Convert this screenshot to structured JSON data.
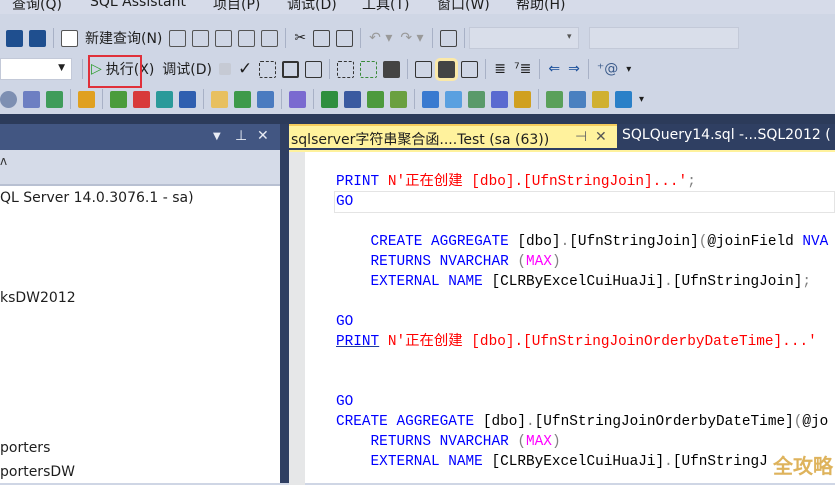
{
  "menu": [
    "查询(Q)",
    "SQL Assistant",
    "项目(P)",
    "调试(D)",
    "工具(T)",
    "窗口(W)",
    "帮助(H)"
  ],
  "toolbar1": {
    "new_query": "新建查询(N)",
    "icons": [
      "save-icon",
      "save-all-icon",
      "new-query-icon",
      "mdx-query-icon",
      "dmx-query-icon",
      "xmla-query-icon",
      "dax-query-icon",
      "cut-icon",
      "copy-icon",
      "paste-icon",
      "undo-icon",
      "redo-icon",
      "activity-monitor-icon"
    ]
  },
  "toolbar2": {
    "execute": "执行(X)",
    "debug": "调试(D)",
    "icons": [
      "execute-play-icon",
      "stop-icon",
      "parse-check-icon",
      "display-plan-icon",
      "query-options-icon",
      "intellisense-icon",
      "results-to-text-icon",
      "results-to-grid-icon",
      "results-to-file-icon",
      "comment-icon",
      "uncomment-icon",
      "decrease-indent-icon",
      "increase-indent-icon",
      "specify-values-icon"
    ]
  },
  "colors": {
    "accent_tab": "#fff29d",
    "title_bar": "#425682",
    "keyword": "#0000ff",
    "string": "#ff0000",
    "function": "#ff00ff",
    "highlight_box": "#e0303a"
  },
  "object_explorer": {
    "header": "ʌ",
    "items": [
      "QL Server 14.0.3076.1 - sa)",
      "ksDW2012",
      "porters",
      "portersDW"
    ]
  },
  "tabs": [
    {
      "label": "sqlserver字符串聚合函....Test (sa (63))",
      "active": true
    },
    {
      "label": "SQLQuery14.sql -...SQL2012 (",
      "active": false
    }
  ],
  "code": [
    [
      [
        "k",
        "PRINT"
      ],
      [
        "n",
        " "
      ],
      [
        "s",
        "N'正在创建 [dbo].[UfnStringJoin]...'"
      ],
      [
        "p",
        ";"
      ]
    ],
    [
      [
        "k",
        "GO"
      ]
    ],
    [],
    [
      [
        "n",
        "    "
      ],
      [
        "k",
        "CREATE AGGREGATE"
      ],
      [
        "n",
        " [dbo]"
      ],
      [
        "p",
        "."
      ],
      [
        "n",
        "[UfnStringJoin]"
      ],
      [
        "p",
        "("
      ],
      [
        "n",
        "@joinField "
      ],
      [
        "k",
        "NVA"
      ]
    ],
    [
      [
        "n",
        "    "
      ],
      [
        "k",
        "RETURNS NVARCHAR"
      ],
      [
        "n",
        " "
      ],
      [
        "p",
        "("
      ],
      [
        "m",
        "MAX"
      ],
      [
        "p",
        ")"
      ]
    ],
    [
      [
        "n",
        "    "
      ],
      [
        "k",
        "EXTERNAL NAME"
      ],
      [
        "n",
        " [CLRByExcelCuiHuaJi]"
      ],
      [
        "p",
        "."
      ],
      [
        "n",
        "[UfnStringJoin]"
      ],
      [
        "p",
        ";"
      ]
    ],
    [],
    [
      [
        "k",
        "GO"
      ]
    ],
    [
      [
        "k ul",
        "PRINT"
      ],
      [
        "n",
        " "
      ],
      [
        "s",
        "N'正在创建 [dbo].[UfnStringJoinOrderbyDateTime]...'"
      ]
    ],
    [],
    [],
    [
      [
        "k",
        "GO"
      ]
    ],
    [
      [
        "k",
        "CREATE AGGREGATE"
      ],
      [
        "n",
        " [dbo]"
      ],
      [
        "p",
        "."
      ],
      [
        "n",
        "[UfnStringJoinOrderbyDateTime]"
      ],
      [
        "p",
        "("
      ],
      [
        "n",
        "@jo"
      ]
    ],
    [
      [
        "n",
        "    "
      ],
      [
        "k",
        "RETURNS NVARCHAR"
      ],
      [
        "n",
        " "
      ],
      [
        "p",
        "("
      ],
      [
        "m",
        "MAX"
      ],
      [
        "p",
        ")"
      ]
    ],
    [
      [
        "n",
        "    "
      ],
      [
        "k",
        "EXTERNAL NAME"
      ],
      [
        "n",
        " [CLRByExcelCuiHuaJi]"
      ],
      [
        "p",
        "."
      ],
      [
        "n",
        "[UfnStringJ"
      ]
    ]
  ],
  "watermark": "全攻略"
}
